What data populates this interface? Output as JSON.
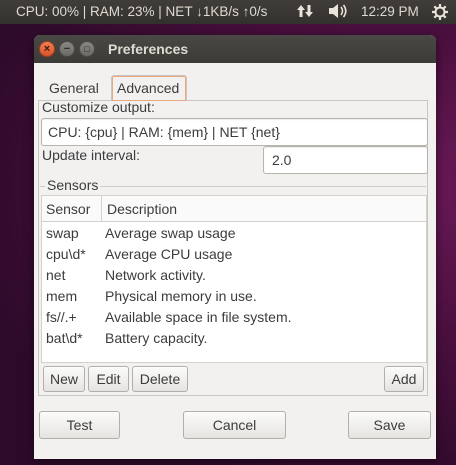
{
  "panel": {
    "indicator_text": "CPU: 00% | RAM: 23% | NET ↓1KB/s ↑0/s",
    "network_icon": "network-updown-icon",
    "volume_icon": "volume-icon",
    "time": "12:29 PM",
    "settings_icon": "gear-icon"
  },
  "window": {
    "title": "Preferences",
    "close_glyph": "×",
    "min_glyph": "−",
    "max_glyph": "□"
  },
  "tabs": [
    {
      "label": "General",
      "selected": false
    },
    {
      "label": "Advanced",
      "selected": true
    }
  ],
  "advanced": {
    "customize_label": "Customize output:",
    "customize_value": "CPU: {cpu} | RAM: {mem} | NET {net}",
    "interval_label": "Update interval:",
    "interval_value": "2.0",
    "sensors_legend": "Sensors",
    "columns": [
      "Sensor",
      "Description"
    ],
    "rows": [
      {
        "sensor": "swap",
        "description": "Average swap usage"
      },
      {
        "sensor": "cpu\\d*",
        "description": "Average CPU usage"
      },
      {
        "sensor": "net",
        "description": "Network activity."
      },
      {
        "sensor": "mem",
        "description": "Physical memory in use."
      },
      {
        "sensor": "fs//.+",
        "description": "Available space in file system."
      },
      {
        "sensor": "bat\\d*",
        "description": "Battery capacity."
      }
    ],
    "buttons": {
      "new": "New",
      "edit": "Edit",
      "delete": "Delete",
      "add": "Add"
    }
  },
  "footer": {
    "test": "Test",
    "cancel": "Cancel",
    "save": "Save"
  },
  "colors": {
    "accent": "#dd4814",
    "panel": "#3c3b37",
    "window_bg": "#f2f1f0"
  }
}
